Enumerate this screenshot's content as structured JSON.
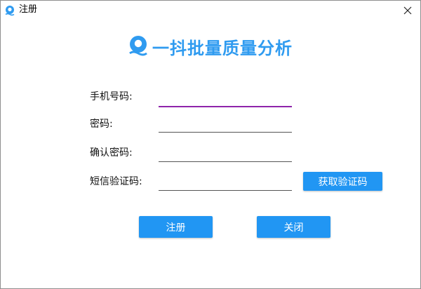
{
  "window": {
    "title": "注册"
  },
  "logo": {
    "text": "一抖批量质量分析"
  },
  "form": {
    "phone_label": "手机号码:",
    "phone_value": "",
    "password_label": "密码:",
    "password_value": "",
    "confirm_label": "确认密码:",
    "confirm_value": "",
    "sms_label": "短信验证码:",
    "sms_value": "",
    "get_code_button": "获取验证码"
  },
  "actions": {
    "register_button": "注册",
    "close_button": "关闭"
  },
  "colors": {
    "accent": "#2196f3",
    "logo": "#2f9bf0",
    "focus_underline": "#8e24aa"
  }
}
